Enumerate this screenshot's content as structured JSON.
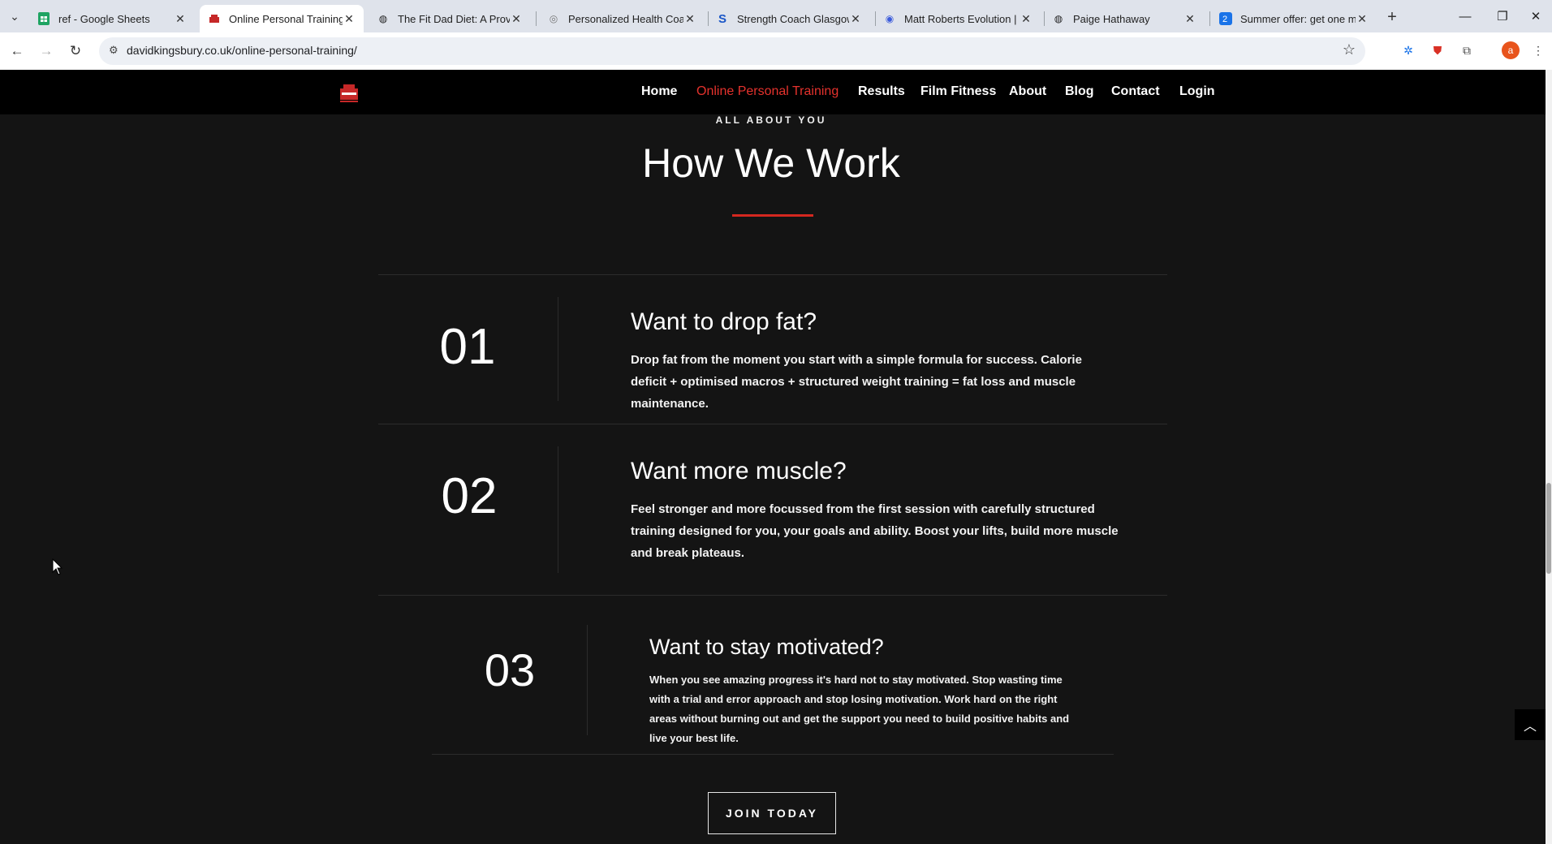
{
  "browser": {
    "tabs": [
      {
        "title": "ref - Google Sheets",
        "icon": "sheets-icon",
        "active": false
      },
      {
        "title": "Online Personal Training |",
        "icon": "kingsbury-icon",
        "active": true
      },
      {
        "title": "The Fit Dad Diet: A Proven",
        "icon": "globe-icon",
        "active": false
      },
      {
        "title": "Personalized Health Coach",
        "icon": "coach-icon",
        "active": false
      },
      {
        "title": "Strength Coach Glasgow",
        "icon": "s-logo-icon",
        "active": false
      },
      {
        "title": "Matt Roberts Evolution | T",
        "icon": "mr-logo-icon",
        "active": false
      },
      {
        "title": "Paige Hathaway",
        "icon": "globe-icon",
        "active": false
      },
      {
        "title": "Summer offer: get one m",
        "icon": "offer-icon",
        "active": false
      }
    ],
    "url": "davidkingsbury.co.uk/online-personal-training/",
    "profile_initial": "a"
  },
  "nav": {
    "items": [
      "Home",
      "Online Personal Training",
      "Results",
      "Film Fitness",
      "About",
      "Blog",
      "Contact",
      "Login"
    ],
    "current": "Online Personal Training"
  },
  "section": {
    "eyebrow": "ALL ABOUT YOU",
    "title": "How We Work",
    "accent_color": "#d4281f"
  },
  "steps": [
    {
      "number": "01",
      "title": "Want to drop fat?",
      "text": "Drop fat from the moment you start with a simple formula for success. Calorie deficit + optimised macros + structured weight training = fat loss and muscle maintenance."
    },
    {
      "number": "02",
      "title": "Want more muscle?",
      "text": "Feel stronger and more focussed from the first session with carefully structured training designed for you, your goals and ability. Boost your lifts, build more muscle and break plateaus."
    },
    {
      "number": "03",
      "title": "Want to stay motivated?",
      "text": "When you see amazing progress it's hard not to stay motivated. Stop wasting time with a trial and error approach and stop losing motivation. Work hard on the right areas without burning out and get the support you need to build positive habits and live your best life."
    }
  ],
  "cta": {
    "label": "JOIN TODAY"
  }
}
